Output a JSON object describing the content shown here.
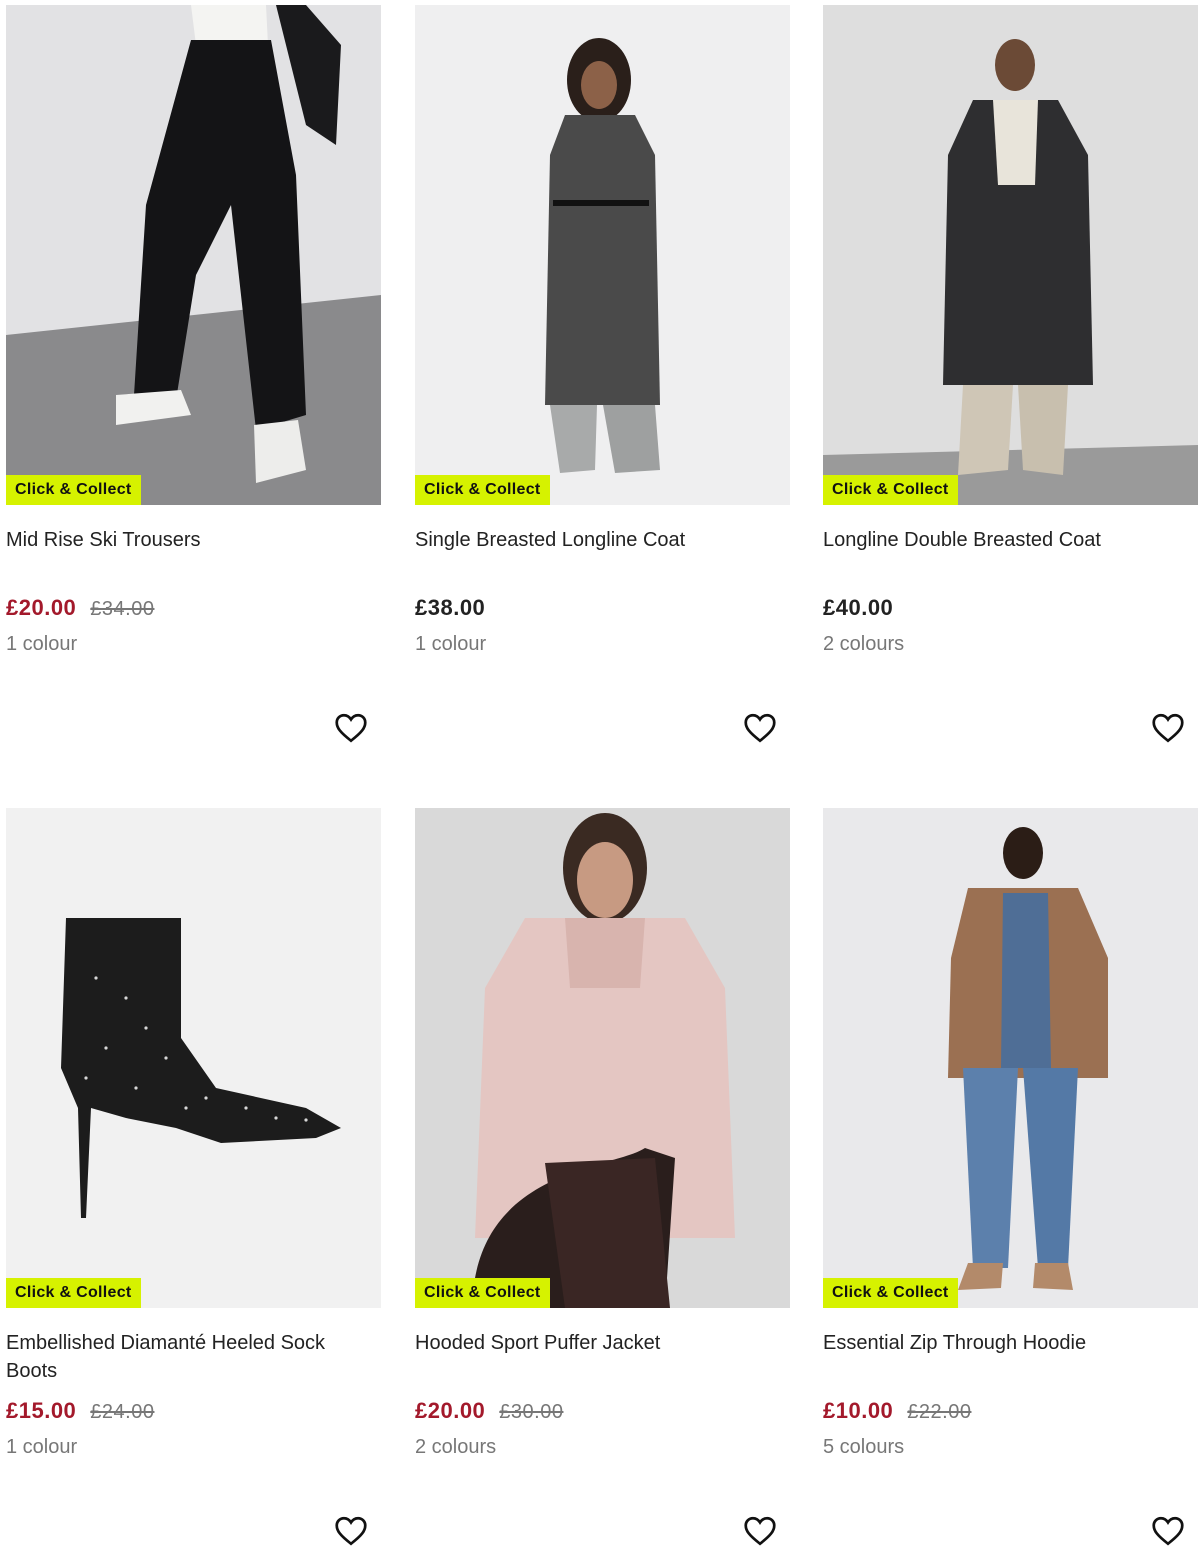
{
  "products": [
    {
      "title": "Mid Rise Ski Trousers",
      "badge": "Click & Collect",
      "price": "£20.00",
      "was_price": "£34.00",
      "colours": "1 colour",
      "on_sale": true,
      "image": "black-ski-trousers-photo"
    },
    {
      "title": "Single Breasted Longline Coat",
      "badge": "Click & Collect",
      "price": "£38.00",
      "was_price": "",
      "colours": "1 colour",
      "on_sale": false,
      "image": "grey-longline-coat-photo"
    },
    {
      "title": "Longline Double Breasted Coat",
      "badge": "Click & Collect",
      "price": "£40.00",
      "was_price": "",
      "colours": "2 colours",
      "on_sale": false,
      "image": "charcoal-double-breasted-coat-photo"
    },
    {
      "title": "Embellished Diamanté Heeled Sock Boots",
      "badge": "Click & Collect",
      "price": "£15.00",
      "was_price": "£24.00",
      "colours": "1 colour",
      "on_sale": true,
      "image": "black-diamante-sock-boot-photo"
    },
    {
      "title": "Hooded Sport Puffer Jacket",
      "badge": "Click & Collect",
      "price": "£20.00",
      "was_price": "£30.00",
      "colours": "2 colours",
      "on_sale": true,
      "image": "pink-puffer-jacket-photo"
    },
    {
      "title": "Essential Zip Through Hoodie",
      "badge": "Click & Collect",
      "price": "£10.00",
      "was_price": "£22.00",
      "colours": "5 colours",
      "on_sale": true,
      "image": "brown-fleece-hoodie-photo"
    }
  ],
  "icons": {
    "favourite": "heart-outline-icon"
  },
  "colors": {
    "badge_bg": "#d6f200",
    "sale_price": "#a3192b",
    "muted_text": "#777777"
  }
}
